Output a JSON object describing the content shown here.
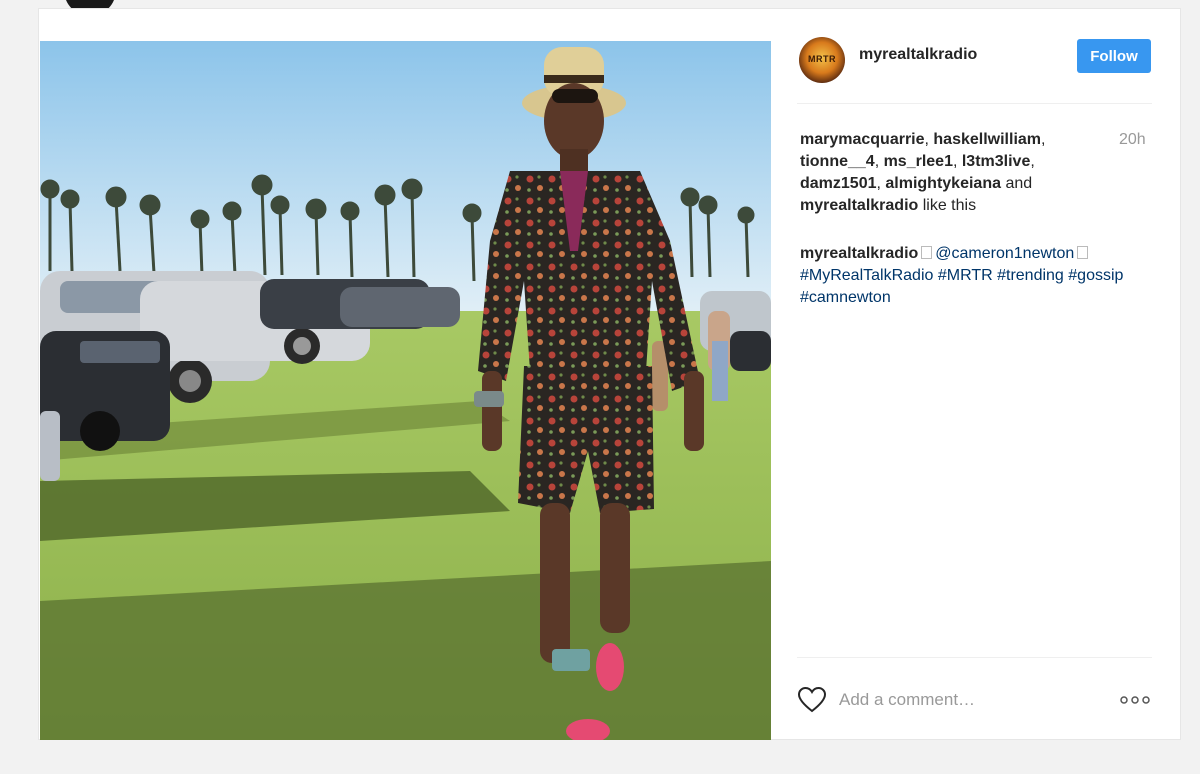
{
  "post": {
    "username": "myrealtalkradio",
    "avatar_text": "MRTR",
    "follow_label": "Follow",
    "time_ago": "20h",
    "likers": [
      "marymacquarrie",
      "haskellwilliam",
      "tionne__4",
      "ms_rlee1",
      "l3tm3live",
      "damz1501",
      "almightykeiana",
      "myrealtalkradio"
    ],
    "likes_sep_1": ", ",
    "likes_and": " and",
    "likes_suffix": " like this",
    "caption": {
      "user": "myrealtalkradio",
      "mention": "@cameron1newton",
      "hashtags": "#MyRealTalkRadio #MRTR #trending #gossip #camnewton"
    },
    "comment_placeholder": "Add a comment…"
  },
  "icons": {
    "heart": "heart-icon",
    "more": "more-options-icon"
  },
  "colors": {
    "accent": "#3897f0",
    "link": "#003569"
  }
}
